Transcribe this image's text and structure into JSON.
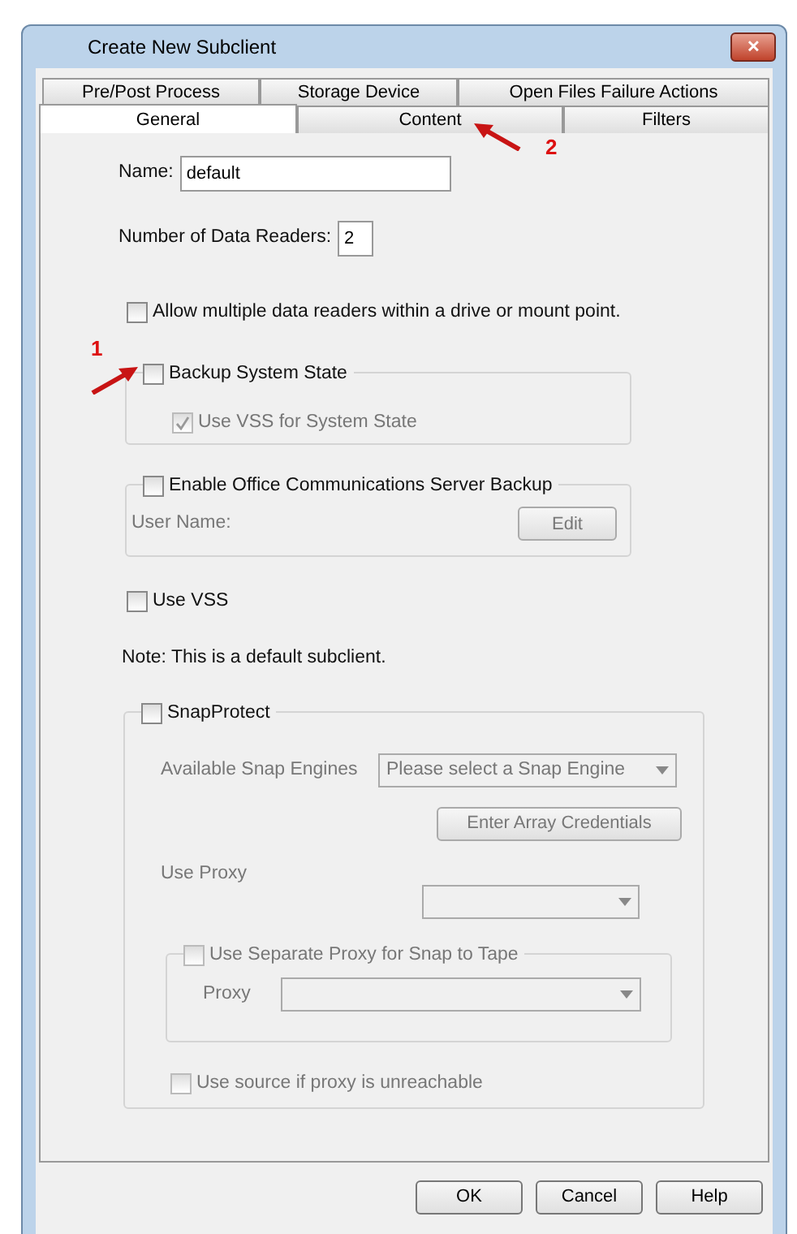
{
  "window": {
    "title": "Create New Subclient",
    "close": "✕"
  },
  "tab_rows": [
    [
      {
        "label": "Pre/Post Process",
        "selected": false
      },
      {
        "label": "Storage Device",
        "selected": false
      },
      {
        "label": "Open Files Failure Actions",
        "selected": false
      }
    ],
    [
      {
        "label": "General",
        "selected": true
      },
      {
        "label": "Content",
        "selected": false,
        "annotation": "2"
      },
      {
        "label": "Filters",
        "selected": false
      }
    ]
  ],
  "name": {
    "label": "Name:",
    "value": "default"
  },
  "data_readers": {
    "label": "Number of Data Readers:",
    "value": "2"
  },
  "allow_multiple": {
    "label": "Allow multiple data readers within a drive or mount point.",
    "checked": false
  },
  "backup_system_state": {
    "label": "Backup System State",
    "checked": false,
    "annotation": "1",
    "use_vss": {
      "label": "Use VSS for System State",
      "checked": true,
      "disabled": true
    }
  },
  "office": {
    "label": "Enable Office Communications Server Backup",
    "checked": false,
    "user_name_label": "User Name:",
    "edit_button": "Edit"
  },
  "use_vss": {
    "label": "Use VSS",
    "checked": false
  },
  "note": "Note: This is a default subclient.",
  "snap": {
    "label": "SnapProtect",
    "checked": false,
    "engines_label": "Available Snap Engines",
    "engines_value": "Please select a Snap Engine",
    "credentials_button": "Enter Array Credentials",
    "proxy_label": "Use Proxy",
    "separate": {
      "label": "Use Separate Proxy for Snap to Tape",
      "checked": false,
      "disabled": true,
      "proxy_label": "Proxy"
    },
    "use_source": {
      "label": "Use source if proxy is unreachable",
      "checked": false,
      "disabled": true
    }
  },
  "buttons": [
    "OK",
    "Cancel",
    "Help"
  ]
}
